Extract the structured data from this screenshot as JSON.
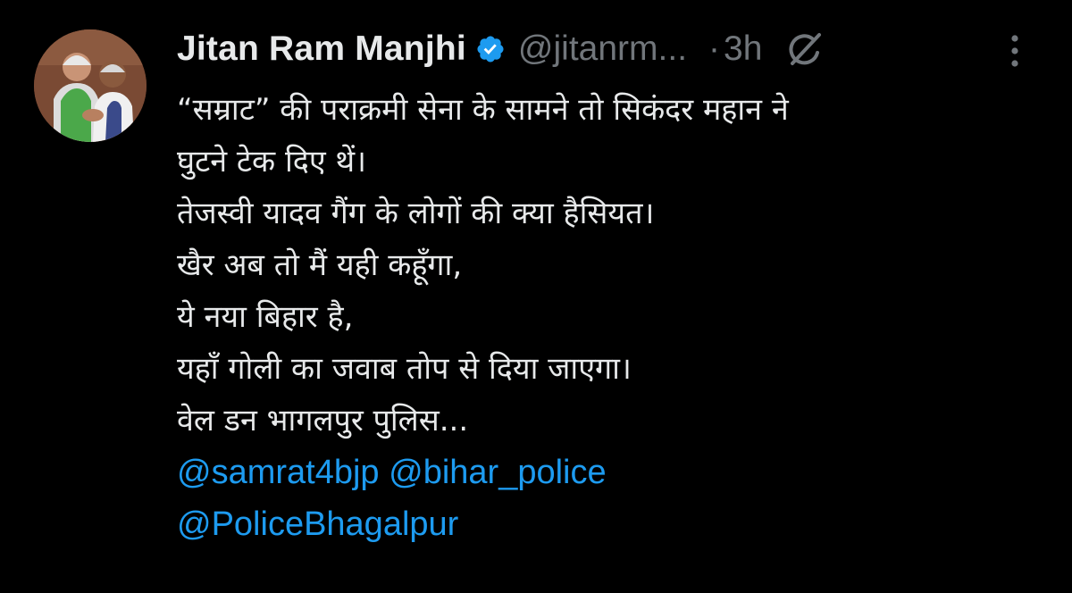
{
  "author": {
    "name": "Jitan Ram Manjhi",
    "handle": "@jitanrm...",
    "time": "3h",
    "separator": "·",
    "verified_color": "#1d9bf0"
  },
  "icons": {
    "avatar": "profile-photo",
    "verified": "verified-badge-icon",
    "grok": "grok-icon",
    "more": "more-options-icon"
  },
  "text_lines": [
    "“सम्राट” की पराक्रमी सेना के सामने तो सिकंदर महान ने",
    "घुटने टेक दिए थें।",
    "तेजस्वी यादव गैंग के लोगों की क्या हैसियत।",
    "खैर अब तो मैं यही कहूँगा,",
    "ये नया बिहार है,",
    "यहाँ गोली का जवाब तोप से दिया जाएगा।",
    "वेल डन भागलपुर पुलिस..."
  ],
  "mentions": {
    "samrat": "@samrat4bjp",
    "bihar_police": "@bihar_police",
    "police_bhagalpur": "@PoliceBhagalpur"
  },
  "colors": {
    "background": "#000000",
    "text": "#e7e9ea",
    "muted": "#71767b",
    "link": "#1d9bf0"
  }
}
